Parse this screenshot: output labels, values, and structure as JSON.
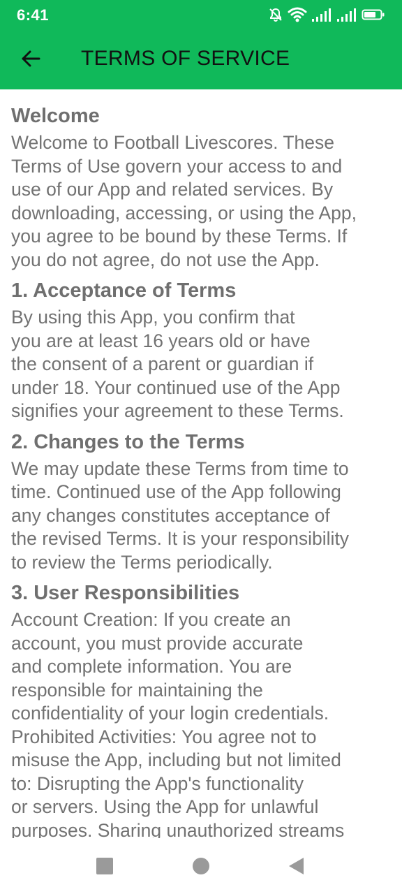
{
  "status_bar": {
    "time": "6:41",
    "icons": [
      "mute-bell-icon",
      "wifi-icon",
      "signal-icon",
      "signal-icon",
      "battery-icon"
    ],
    "background_color": "#10b95a"
  },
  "app_bar": {
    "title": "TERMS OF SERVICE",
    "back_icon": "arrow-back-icon",
    "background_color": "#10b95a"
  },
  "sections": [
    {
      "heading": "Welcome",
      "body": "Welcome to Football Livescores. These\nTerms of Use govern your access to and\nuse of our App and related services. By\ndownloading, accessing, or using the App,\nyou agree to be bound by these Terms. If\nyou do not agree, do not use the App."
    },
    {
      "heading": "1. Acceptance of Terms",
      "body": "By using this App, you confirm that\nyou are at least 16 years old or have\nthe consent of a parent or guardian if\nunder 18. Your continued use of the App\nsignifies your agreement to these Terms."
    },
    {
      "heading": "2. Changes to the Terms",
      "body": "We may update these Terms from time to\ntime. Continued use of the App following\nany changes constitutes acceptance of\nthe revised Terms. It is your responsibility\nto review the Terms periodically."
    },
    {
      "heading": "3. User Responsibilities",
      "body": "Account Creation: If you create an\naccount, you must provide accurate\nand complete information. You are\nresponsible for maintaining the\nconfidentiality of your login credentials.\nProhibited Activities: You agree not to\nmisuse the App, including but not limited\nto: Disrupting the App's functionality\nor servers. Using the App for unlawful\npurposes. Sharing unauthorized streams"
    }
  ],
  "nav_bar": {
    "buttons": [
      "recents-square-icon",
      "home-circle-icon",
      "back-triangle-icon"
    ]
  }
}
